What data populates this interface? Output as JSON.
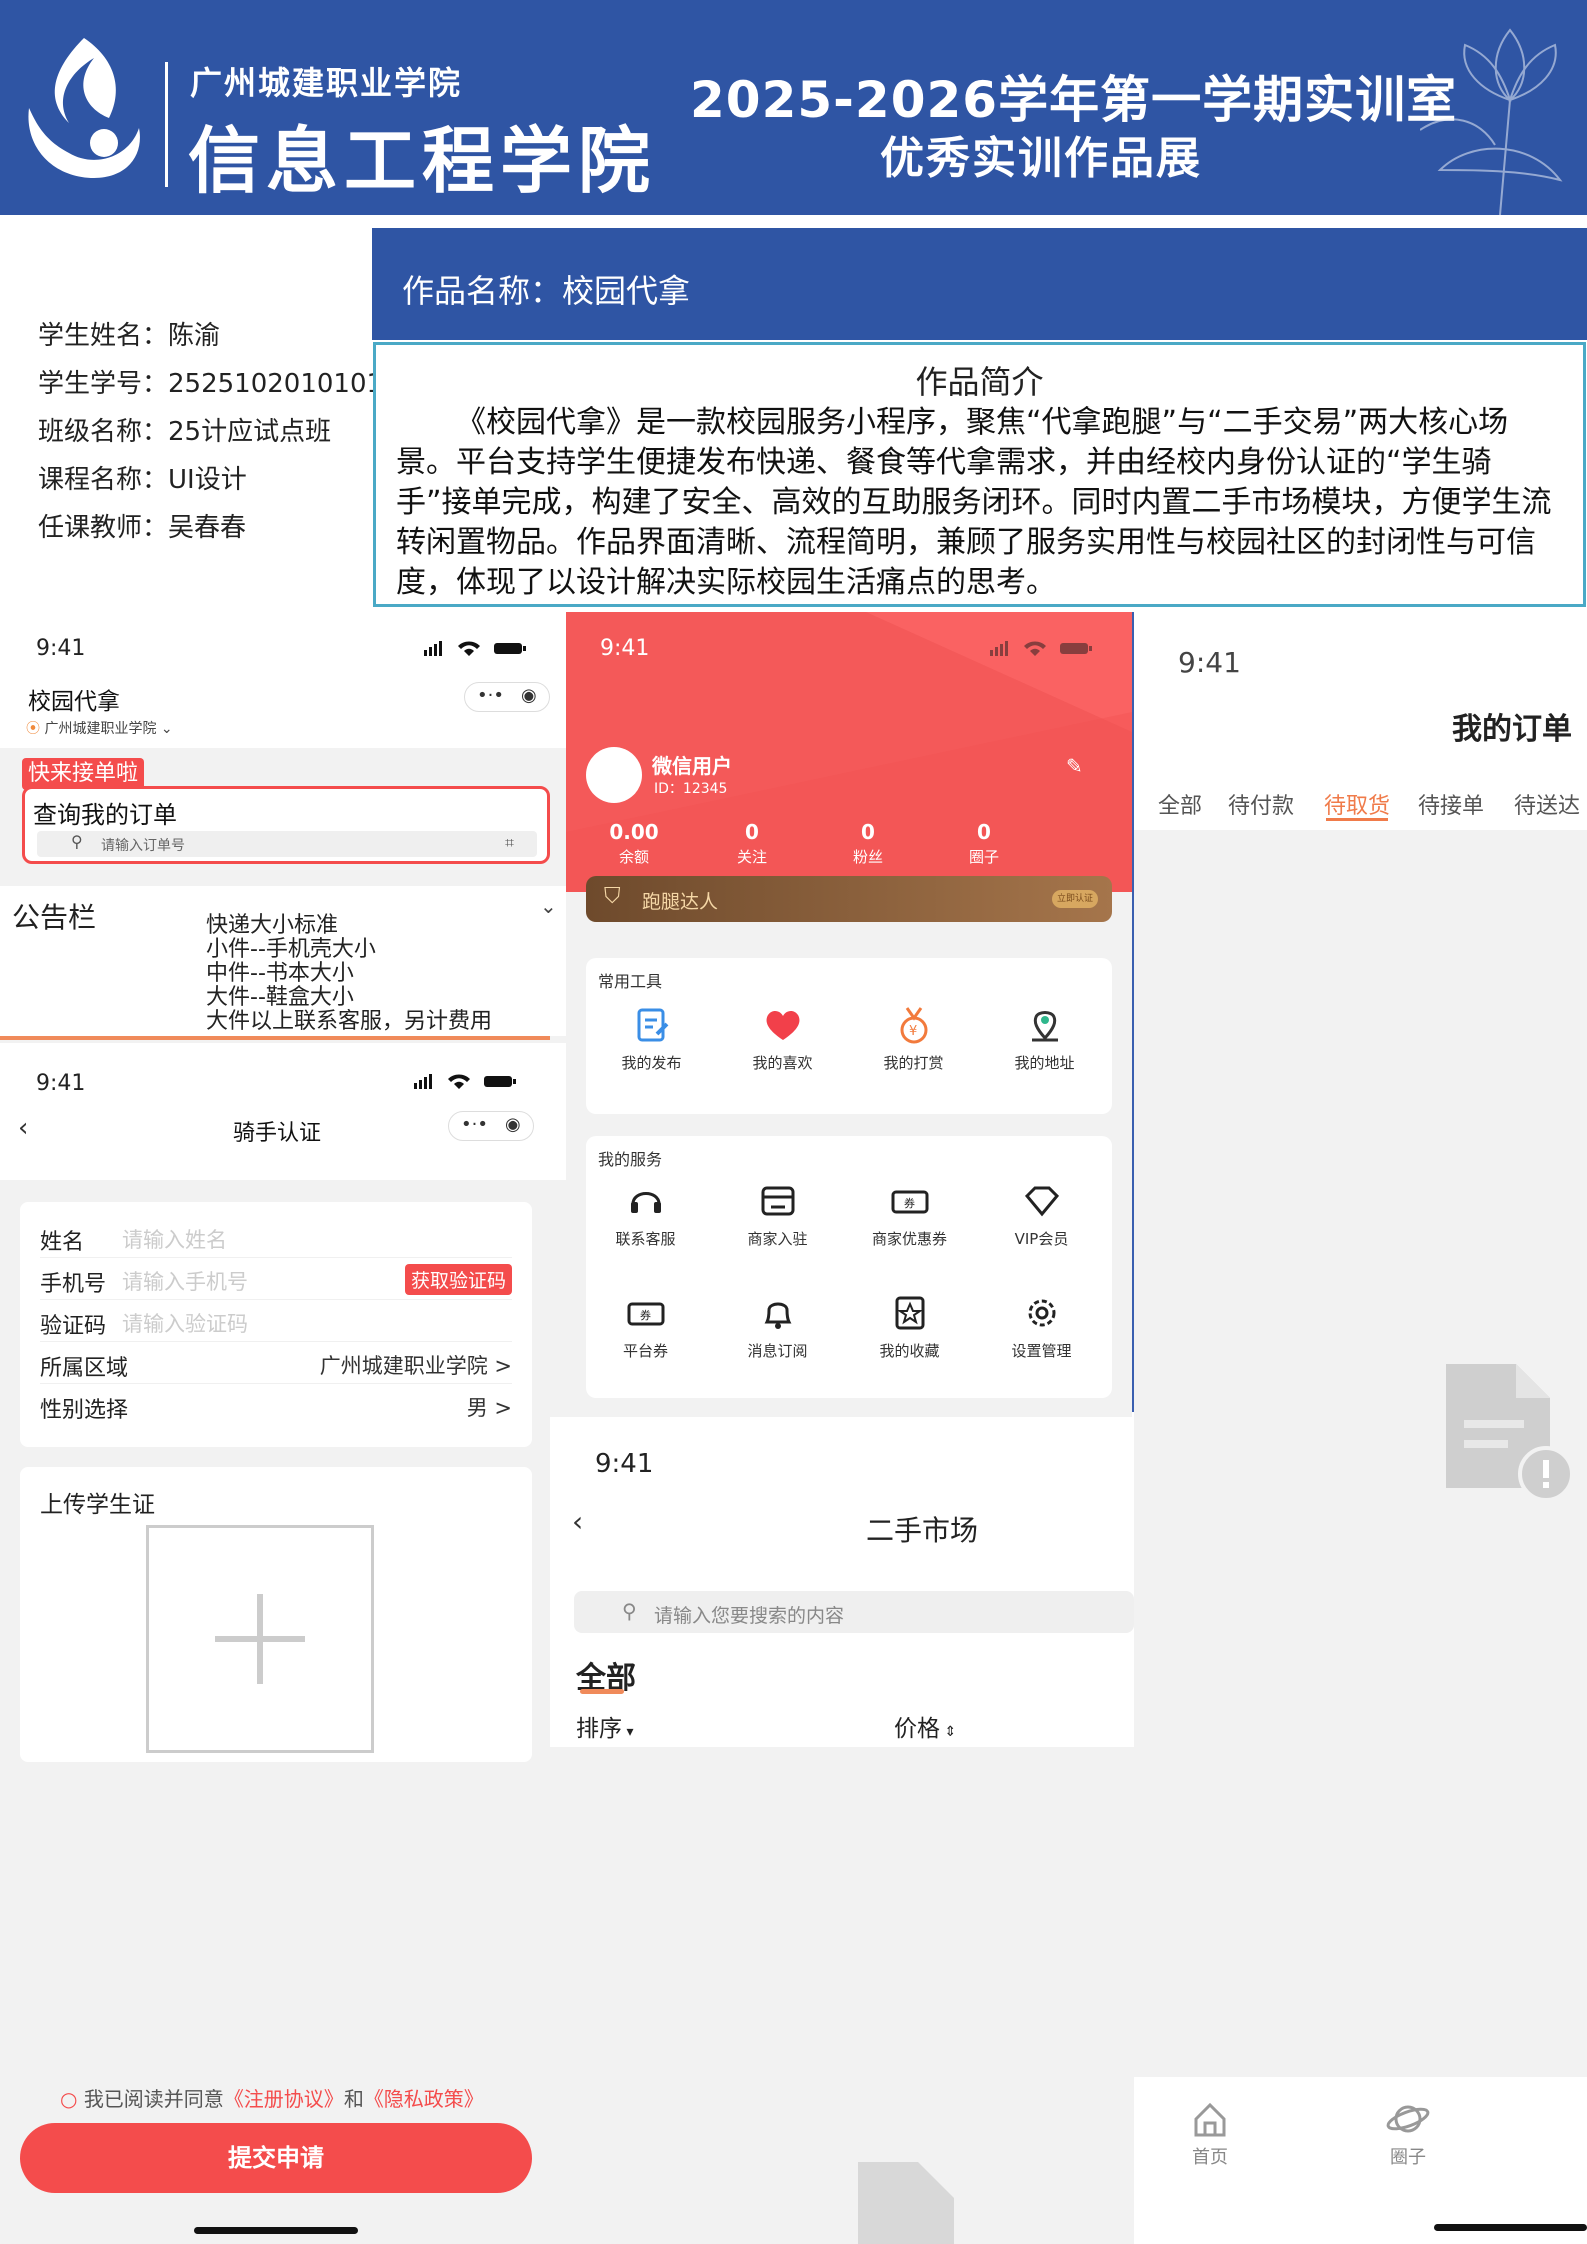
{
  "banner": {
    "school": "广州城建职业学院",
    "college": "信息工程学院",
    "title_line1": "2025-2026学年第一学期实训室",
    "title_line2": "优秀实训作品展"
  },
  "student": {
    "name": "学生姓名：陈渝",
    "id": "学生学号：2525102010101",
    "class": "班级名称：25计应试点班",
    "course": "课程名称：UI设计",
    "teacher": "任课教师：吴春春"
  },
  "work": {
    "title": "作品名称：校园代拿",
    "intro_heading": "作品简介",
    "intro_text": "《校园代拿》是一款校园服务小程序，聚焦“代拿跑腿”与“二手交易”两大核心场景。平台支持学生便捷发布快递、餐食等代拿需求，并由经校内身份认证的“学生骑手”接单完成，构建了安全、高效的互助服务闭环。同时内置二手市场模块，方便学生流转闲置物品。作品界面清晰、流程简明，兼顾了服务实用性与校园社区的封闭性与可信度，体现了以设计解决实际校园生活痛点的思考。"
  },
  "status_time": "9:41",
  "home": {
    "app_name": "校园代拿",
    "location": "广州城建职业学院",
    "quick_tag": "快来接单啦",
    "order_title": "查询我的订单",
    "order_placeholder": "请输入订单号",
    "notice_title": "公告栏",
    "notice_lines": [
      "快递大小标准",
      "小件--手机壳大小",
      "中件--书本大小",
      "大件--鞋盒大小",
      "大件以上联系客服，另计费用"
    ]
  },
  "rider": {
    "title": "骑手认证",
    "fields": [
      {
        "label": "姓名",
        "placeholder": "请输入姓名"
      },
      {
        "label": "手机号",
        "placeholder": "请输入手机号"
      },
      {
        "label": "验证码",
        "placeholder": "请输入验证码"
      },
      {
        "label": "所属区域",
        "value": "广州城建职业学院 >"
      },
      {
        "label": "性别选择",
        "value": "男 >"
      }
    ],
    "get_code": "获取验证码",
    "upload_title": "上传学生证",
    "agree_prefix": "我已阅读并同意",
    "agree_reg": "《注册协议》",
    "agree_and": "和",
    "agree_privacy": "《隐私政策》",
    "submit": "提交申请"
  },
  "profile": {
    "nickname": "微信用户",
    "user_id": "ID：12345",
    "stats": [
      {
        "num": "0.00",
        "label": "余额"
      },
      {
        "num": "0",
        "label": "关注"
      },
      {
        "num": "0",
        "label": "粉丝"
      },
      {
        "num": "0",
        "label": "圈子"
      }
    ],
    "vip_text": "跑腿达人",
    "vip_badge": "立即认证",
    "tools_title": "常用工具",
    "tools": [
      "我的发布",
      "我的喜欢",
      "我的打赏",
      "我的地址"
    ],
    "services_title": "我的服务",
    "services": [
      "联系客服",
      "商家入驻",
      "商家优惠券",
      "VIP会员",
      "平台券",
      "消息订阅",
      "我的收藏",
      "设置管理"
    ]
  },
  "market": {
    "title": "二手市场",
    "search_placeholder": "请输入您要搜索的内容",
    "tab_all": "全部",
    "sort": "排序",
    "price": "价格"
  },
  "orders": {
    "title": "我的订单",
    "tabs": [
      "全部",
      "待付款",
      "待取货",
      "待接单",
      "待送达"
    ],
    "tabbar": [
      "首页",
      "圈子"
    ]
  },
  "colors": {
    "brand_blue": "#2f55a4",
    "accent_red": "#f44c4c",
    "orange": "#f07b4a"
  }
}
